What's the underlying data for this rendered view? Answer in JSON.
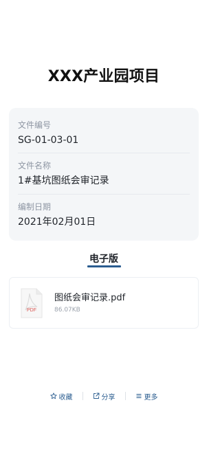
{
  "header": {
    "title": "XXX产业园项目"
  },
  "info": {
    "rows": [
      {
        "label": "文件编号",
        "value": "SG-01-03-01"
      },
      {
        "label": "文件名称",
        "value": "1#基坑图纸会审记录"
      },
      {
        "label": "编制日期",
        "value": "2021年02月01日"
      }
    ]
  },
  "section": {
    "title": "电子版"
  },
  "file": {
    "name": "图纸会审记录.pdf",
    "size": "86.07KB",
    "type_badge": "PDF",
    "icon": "pdf-file-icon"
  },
  "actions": [
    {
      "label": "收藏",
      "icon": "star-icon"
    },
    {
      "label": "分享",
      "icon": "share-icon"
    },
    {
      "label": "更多",
      "icon": "menu-icon"
    }
  ],
  "colors": {
    "accent": "#2a5c8f",
    "pdf_red": "#d9534f",
    "card_bg": "#f4f6f8"
  }
}
